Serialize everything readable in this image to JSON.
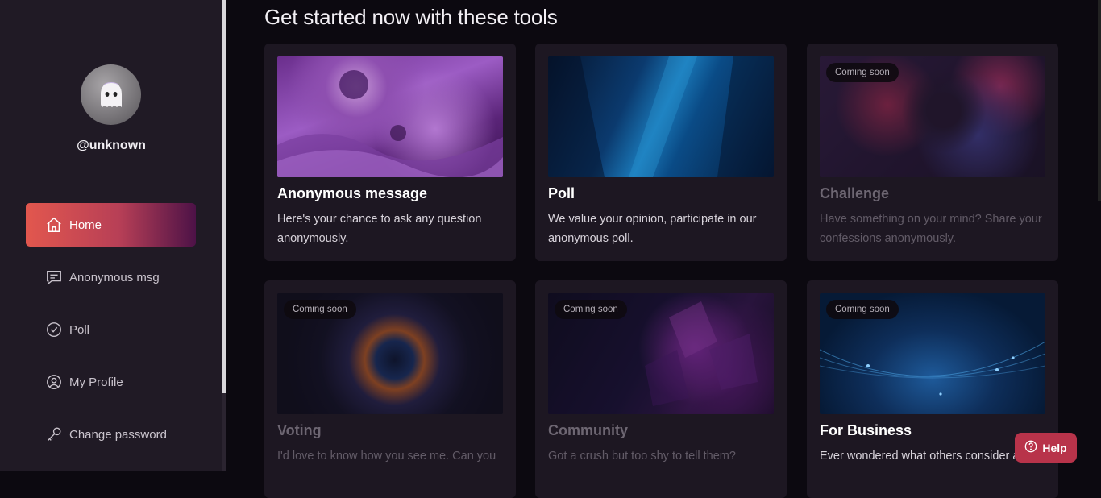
{
  "sidebar": {
    "username": "@unknown",
    "items": [
      {
        "label": "Home",
        "icon": "home-icon",
        "active": true
      },
      {
        "label": "Anonymous msg",
        "icon": "message-icon",
        "active": false
      },
      {
        "label": "Poll",
        "icon": "check-circle-icon",
        "active": false
      },
      {
        "label": "My Profile",
        "icon": "user-circle-icon",
        "active": false
      },
      {
        "label": "Change password",
        "icon": "key-icon",
        "active": false
      }
    ]
  },
  "main": {
    "title": "Get started now with these tools",
    "cards": [
      {
        "title": "Anonymous message",
        "description": "Here's your chance to ask any question anonymously.",
        "badge": ""
      },
      {
        "title": "Poll",
        "description": "We value your opinion, participate in our anonymous poll.",
        "badge": ""
      },
      {
        "title": "Challenge",
        "description": "Have something on your mind? Share your confessions anonymously.",
        "badge": "Coming soon"
      },
      {
        "title": "Voting",
        "description": "I'd love to know how you see me. Can you",
        "badge": "Coming soon"
      },
      {
        "title": "Community",
        "description": "Got a crush but too shy to tell them?",
        "badge": "Coming soon"
      },
      {
        "title": "For Business",
        "description": "Ever wondered what others consider a",
        "badge": "Coming soon"
      }
    ]
  },
  "help": {
    "label": "Help",
    "icon": "question-circle-icon"
  },
  "colors": {
    "accent_start": "#e2574e",
    "accent_end": "#4d1247",
    "help_bg": "#b8334a",
    "sidebar_bg": "#201a25",
    "card_bg": "#1d1722"
  }
}
